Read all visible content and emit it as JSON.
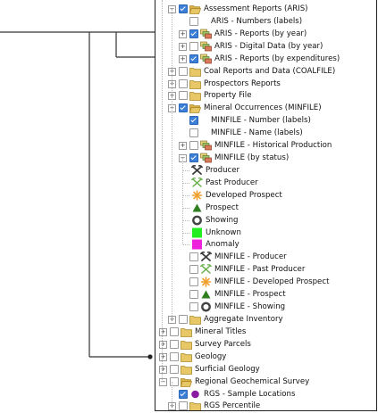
{
  "layers": [
    {
      "label": "Assessment Reports (ARIS)",
      "checked": true,
      "expander": "minus",
      "icon": "folder-open-icon",
      "level": 0
    },
    {
      "label": "ARIS - Numbers (labels)",
      "checked": false,
      "expander": "",
      "icon": "",
      "level": 1
    },
    {
      "label": "ARIS - Reports (by year)",
      "checked": true,
      "expander": "plus",
      "icon": "layer-group-icon",
      "level": 1
    },
    {
      "label": "ARIS - Digital Data (by year)",
      "checked": false,
      "expander": "plus",
      "icon": "layer-group-icon",
      "level": 1
    },
    {
      "label": "ARIS - Reports (by expenditures)",
      "checked": true,
      "expander": "plus",
      "icon": "layer-group-icon",
      "level": 1
    },
    {
      "label": "Coal Reports and Data (COALFILE)",
      "checked": false,
      "expander": "plus",
      "icon": "folder-icon",
      "level": 0
    },
    {
      "label": "Prospectors Reports",
      "checked": false,
      "expander": "plus",
      "icon": "folder-icon",
      "level": 0
    },
    {
      "label": "Property File",
      "checked": false,
      "expander": "plus",
      "icon": "folder-icon",
      "level": 0
    },
    {
      "label": "Mineral Occurrences (MINFILE)",
      "checked": true,
      "expander": "minus",
      "icon": "folder-open-icon",
      "level": 0
    },
    {
      "label": "MINFILE - Number (labels)",
      "checked": true,
      "expander": "",
      "icon": "",
      "level": 1
    },
    {
      "label": "MINFILE - Name (labels)",
      "checked": false,
      "expander": "",
      "icon": "",
      "level": 1
    },
    {
      "label": "MINFILE - Historical Production",
      "checked": false,
      "expander": "plus",
      "icon": "layer-group-icon",
      "level": 1
    },
    {
      "label": "MINFILE (by status)",
      "checked": true,
      "expander": "minus",
      "icon": "layer-group-icon",
      "level": 1
    },
    {
      "label": "Producer",
      "checked": null,
      "expander": "",
      "icon": "producer-pick-icon",
      "level": 2
    },
    {
      "label": "Past Producer",
      "checked": null,
      "expander": "",
      "icon": "past-producer-icon",
      "level": 2
    },
    {
      "label": "Developed Prospect",
      "checked": null,
      "expander": "",
      "icon": "developed-prospect-star-icon",
      "level": 2
    },
    {
      "label": "Prospect",
      "checked": null,
      "expander": "",
      "icon": "prospect-triangle-icon",
      "level": 2
    },
    {
      "label": "Showing",
      "checked": null,
      "expander": "",
      "icon": "showing-ring-icon",
      "level": 2
    },
    {
      "label": "Unknown",
      "checked": null,
      "expander": "",
      "icon": "unknown-square-icon",
      "level": 2
    },
    {
      "label": "Anomaly",
      "checked": null,
      "expander": "",
      "icon": "anomaly-square-icon",
      "level": 2
    },
    {
      "label": "MINFILE - Producer",
      "checked": false,
      "expander": "",
      "icon": "producer-pick-icon",
      "level": 1
    },
    {
      "label": "MINFILE - Past Producer",
      "checked": false,
      "expander": "",
      "icon": "past-producer-icon",
      "level": 1
    },
    {
      "label": "MINFILE - Developed Prospect",
      "checked": false,
      "expander": "",
      "icon": "developed-prospect-star-icon",
      "level": 1
    },
    {
      "label": "MINFILE - Prospect",
      "checked": false,
      "expander": "",
      "icon": "prospect-triangle-icon",
      "level": 1
    },
    {
      "label": "MINFILE - Showing",
      "checked": false,
      "expander": "",
      "icon": "showing-ring-icon",
      "level": 1
    },
    {
      "label": "Aggregate Inventory",
      "checked": false,
      "expander": "plus",
      "icon": "folder-icon",
      "level": 0
    },
    {
      "label": "Mineral Titles",
      "checked": false,
      "expander": "plus",
      "icon": "folder-icon",
      "level": -1
    },
    {
      "label": "Survey Parcels",
      "checked": false,
      "expander": "plus",
      "icon": "folder-icon",
      "level": -1
    },
    {
      "label": "Geology",
      "checked": false,
      "expander": "plus",
      "icon": "folder-icon",
      "level": -1
    },
    {
      "label": "Surficial Geology",
      "checked": false,
      "expander": "plus",
      "icon": "folder-icon",
      "level": -1
    },
    {
      "label": "Regional Geochemical Survey",
      "checked": false,
      "expander": "minus",
      "icon": "folder-open-icon",
      "level": -1
    },
    {
      "label": "RGS - Sample Locations",
      "checked": true,
      "expander": "",
      "icon": "purple-circle-icon",
      "level": 0
    },
    {
      "label": "RGS Percentile",
      "checked": false,
      "expander": "plus",
      "icon": "folder-icon",
      "level": 0
    }
  ],
  "colors": {
    "checkbox_on": "#3b7fd8",
    "folder": "#e8c766",
    "prospect": "#2e7d1e",
    "unknown": "#22ee22",
    "anomaly": "#ee22dd",
    "developed_prospect": "#f0a030",
    "rgs_circle": "#8a1aa0"
  }
}
